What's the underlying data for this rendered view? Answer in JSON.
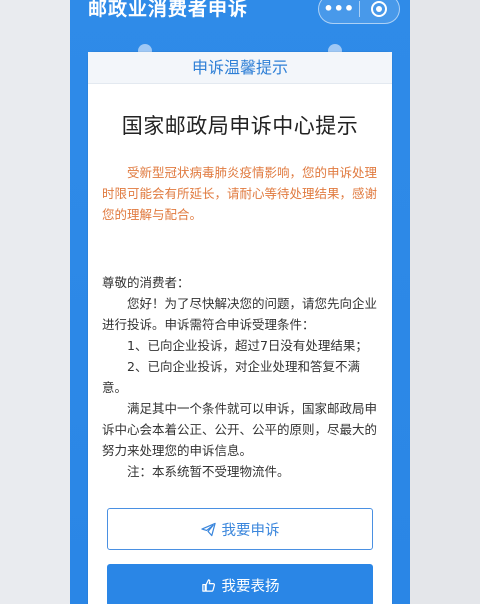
{
  "header": {
    "app_title": "邮政业消费者申诉",
    "more_label": "•••"
  },
  "card": {
    "header_label": "申诉温馨提示",
    "title": "国家邮政局申诉中心提示",
    "orange_note": "受新型冠状病毒肺炎疫情影响，您的申诉处理时限可能会有所延长，请耐心等待处理结果，感谢您的理解与配合。",
    "greeting": "尊敬的消费者：",
    "paragraph_1": "您好！为了尽快解决您的问题，请您先向企业进行投诉。申诉需符合申诉受理条件：",
    "condition_1": "1、已向企业投诉，超过7日没有处理结果；",
    "condition_2": "2、已向企业投诉，对企业处理和答复不满意。",
    "paragraph_2": "满足其中一个条件就可以申诉，国家邮政局申诉中心会本着公正、公开、公平的原则，尽最大的努力来处理您的申诉信息。",
    "note": "注：本系统暂不受理物流件。"
  },
  "buttons": {
    "complain_label": "我要申诉",
    "complain_icon": "paper-plane-icon",
    "praise_label": "我要表扬",
    "praise_icon": "thumbs-up-icon"
  },
  "colors": {
    "brand_blue": "#2a86e6",
    "notice_orange": "#e07a3f"
  }
}
